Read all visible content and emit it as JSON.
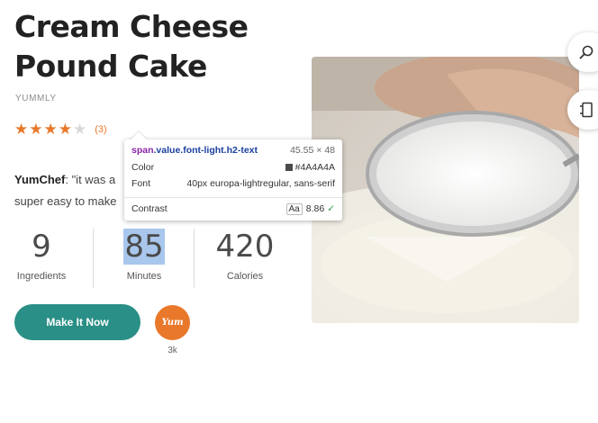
{
  "recipe": {
    "title": "Cream Cheese Pound Cake",
    "source": "YUMMLY",
    "rating_count": "(3)",
    "stars_filled": 4,
    "stars_total": 5,
    "quote_author": "YumChef",
    "quote_text": ": \"it was a",
    "quote_text_line2": "super easy to make"
  },
  "stats": [
    {
      "value": "9",
      "label": "Ingredients"
    },
    {
      "value": "85",
      "label": "Minutes"
    },
    {
      "value": "420",
      "label": "Calories"
    }
  ],
  "actions": {
    "make_it_now": "Make It Now",
    "yum_label": "Yum",
    "yum_count": "3k"
  },
  "inspector": {
    "selector_tag": "span",
    "selector_class": ".value.font-light.h2-text",
    "size": "45.55 × 48",
    "color_label": "Color",
    "color_value": "#4A4A4A",
    "font_label": "Font",
    "font_value": "40px europa-lightregular, sans-serif",
    "contrast_label": "Contrast",
    "contrast_aa": "Aa",
    "contrast_value": "8.86"
  },
  "colors": {
    "accent": "#e9782a",
    "cta": "#2a8f86",
    "highlight": "#a9c7ec",
    "text_value": "#4a4a4a"
  },
  "icons": {
    "search": "search-icon",
    "side": "panel-icon"
  }
}
